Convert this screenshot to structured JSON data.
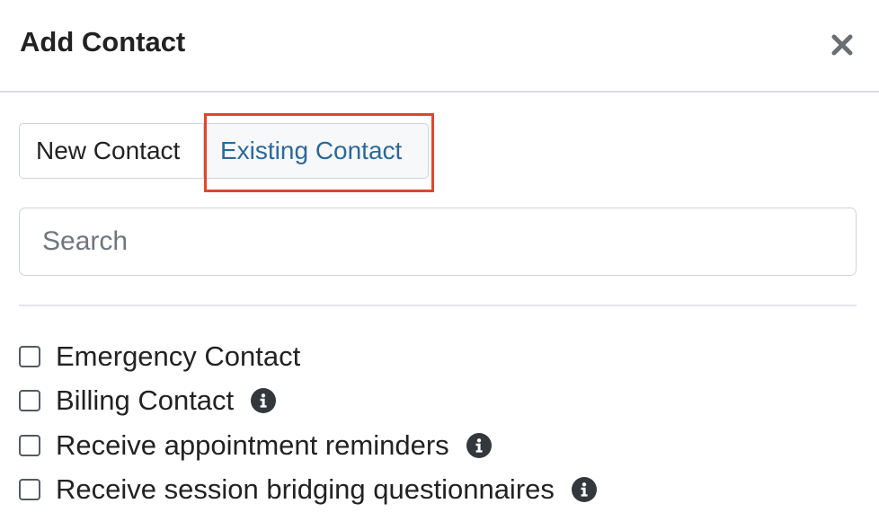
{
  "modal": {
    "title": "Add Contact",
    "close_icon": "close-icon"
  },
  "tabs": [
    {
      "label": "New Contact",
      "active": false
    },
    {
      "label": "Existing Contact",
      "active": true
    }
  ],
  "highlight_color": "#e0462b",
  "search": {
    "placeholder": "Search",
    "value": ""
  },
  "options": [
    {
      "label": "Emergency Contact",
      "checked": false,
      "info_icon": false
    },
    {
      "label": "Billing Contact",
      "checked": false,
      "info_icon": true
    },
    {
      "label": "Receive appointment reminders",
      "checked": false,
      "info_icon": true
    },
    {
      "label": "Receive session bridging questionnaires",
      "checked": false,
      "info_icon": true
    }
  ],
  "colors": {
    "active_tab_text": "#2e6898",
    "info_icon_bg": "#33383d"
  }
}
